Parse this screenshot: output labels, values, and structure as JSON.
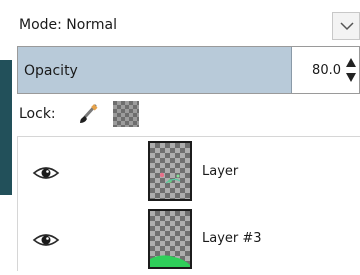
{
  "mode": {
    "label": "Mode: Normal"
  },
  "opacity": {
    "label": "Opacity",
    "value": "80.0",
    "fill_percent": 80
  },
  "lock": {
    "label": "Lock:",
    "icons": [
      "brush-icon",
      "alpha-lock-icon"
    ]
  },
  "layers": [
    {
      "name": "Layer",
      "visible": true,
      "thumbnail": "checkerboard-with-pink-green-marks"
    },
    {
      "name": "Layer #3",
      "visible": true,
      "thumbnail": "checkerboard-with-green-bottom"
    }
  ],
  "colors": {
    "accent_bar": "#22505a",
    "opacity_fill": "#b8cad9",
    "thumb_green": "#2fcf5a"
  }
}
